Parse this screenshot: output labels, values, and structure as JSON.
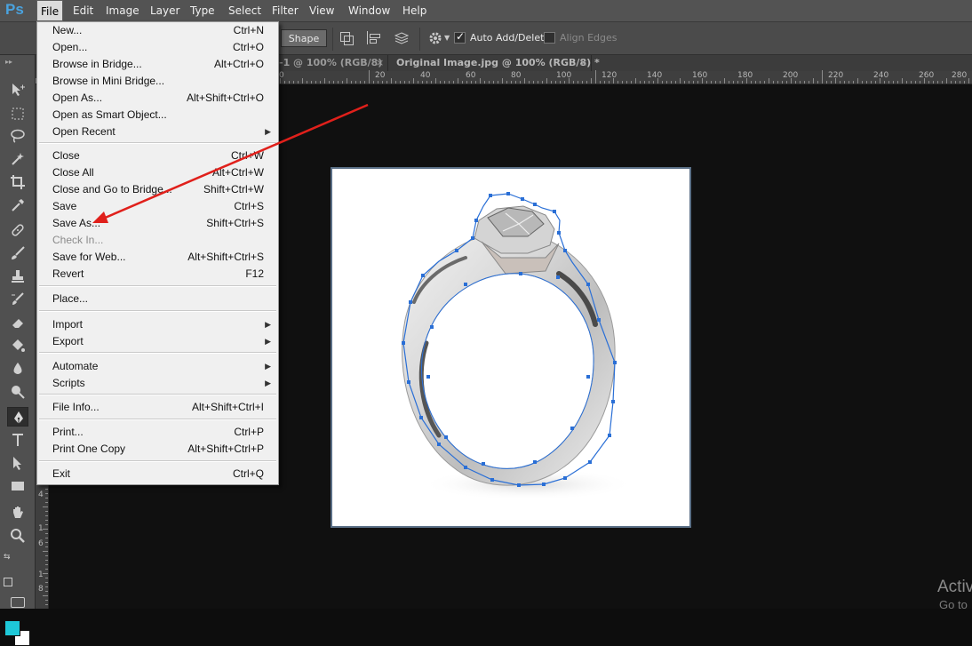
{
  "app": {
    "logo": "Ps"
  },
  "menubar": {
    "items": [
      "File",
      "Edit",
      "Image",
      "Layer",
      "Type",
      "Select",
      "Filter",
      "View",
      "Window",
      "Help"
    ],
    "active": "File"
  },
  "options": {
    "shape_button": "Shape",
    "auto_add_delete": "Auto Add/Delete",
    "auto_add_delete_checked": true,
    "align_edges": "Align Edges",
    "align_edges_checked": false
  },
  "tabs": [
    {
      "label": "-1 @ 100% (RGB/8)",
      "close": "×"
    },
    {
      "label": "Original Image.jpg @ 100% (RGB/8) *",
      "close": "×"
    }
  ],
  "ruler_h_labels": [
    "0",
    "20",
    "40",
    "60",
    "80",
    "100",
    "120",
    "140",
    "160",
    "180",
    "200",
    "220",
    "240",
    "260",
    "280"
  ],
  "ruler_v_labels": [
    "4",
    "1",
    "6",
    "1",
    "8"
  ],
  "file_menu": {
    "items": [
      {
        "label": "New...",
        "shortcut": "Ctrl+N"
      },
      {
        "label": "Open...",
        "shortcut": "Ctrl+O"
      },
      {
        "label": "Browse in Bridge...",
        "shortcut": "Alt+Ctrl+O"
      },
      {
        "label": "Browse in Mini Bridge...",
        "shortcut": ""
      },
      {
        "label": "Open As...",
        "shortcut": "Alt+Shift+Ctrl+O"
      },
      {
        "label": "Open as Smart Object...",
        "shortcut": ""
      },
      {
        "label": "Open Recent",
        "shortcut": "",
        "submenu": true
      },
      {
        "label": "Close",
        "shortcut": "Ctrl+W"
      },
      {
        "label": "Close All",
        "shortcut": "Alt+Ctrl+W"
      },
      {
        "label": "Close and Go to Bridge...",
        "shortcut": "Shift+Ctrl+W"
      },
      {
        "label": "Save",
        "shortcut": "Ctrl+S"
      },
      {
        "label": "Save As...",
        "shortcut": "Shift+Ctrl+S"
      },
      {
        "label": "Check In...",
        "shortcut": "",
        "disabled": true
      },
      {
        "label": "Save for Web...",
        "shortcut": "Alt+Shift+Ctrl+S"
      },
      {
        "label": "Revert",
        "shortcut": "F12"
      },
      {
        "label": "Place...",
        "shortcut": ""
      },
      {
        "label": "Import",
        "shortcut": "",
        "submenu": true
      },
      {
        "label": "Export",
        "shortcut": "",
        "submenu": true
      },
      {
        "label": "Automate",
        "shortcut": "",
        "submenu": true
      },
      {
        "label": "Scripts",
        "shortcut": "",
        "submenu": true
      },
      {
        "label": "File Info...",
        "shortcut": "Alt+Shift+Ctrl+I"
      },
      {
        "label": "Print...",
        "shortcut": "Ctrl+P"
      },
      {
        "label": "Print One Copy",
        "shortcut": "Alt+Shift+Ctrl+P"
      },
      {
        "label": "Exit",
        "shortcut": "Ctrl+Q"
      }
    ]
  },
  "colors": {
    "foreground": "#1ec8d8",
    "background": "#ffffff",
    "path_blue": "#2a6fd6",
    "arrow_red": "#e0201b"
  },
  "watermark": {
    "line1": "Activ",
    "line2": "Go to"
  }
}
